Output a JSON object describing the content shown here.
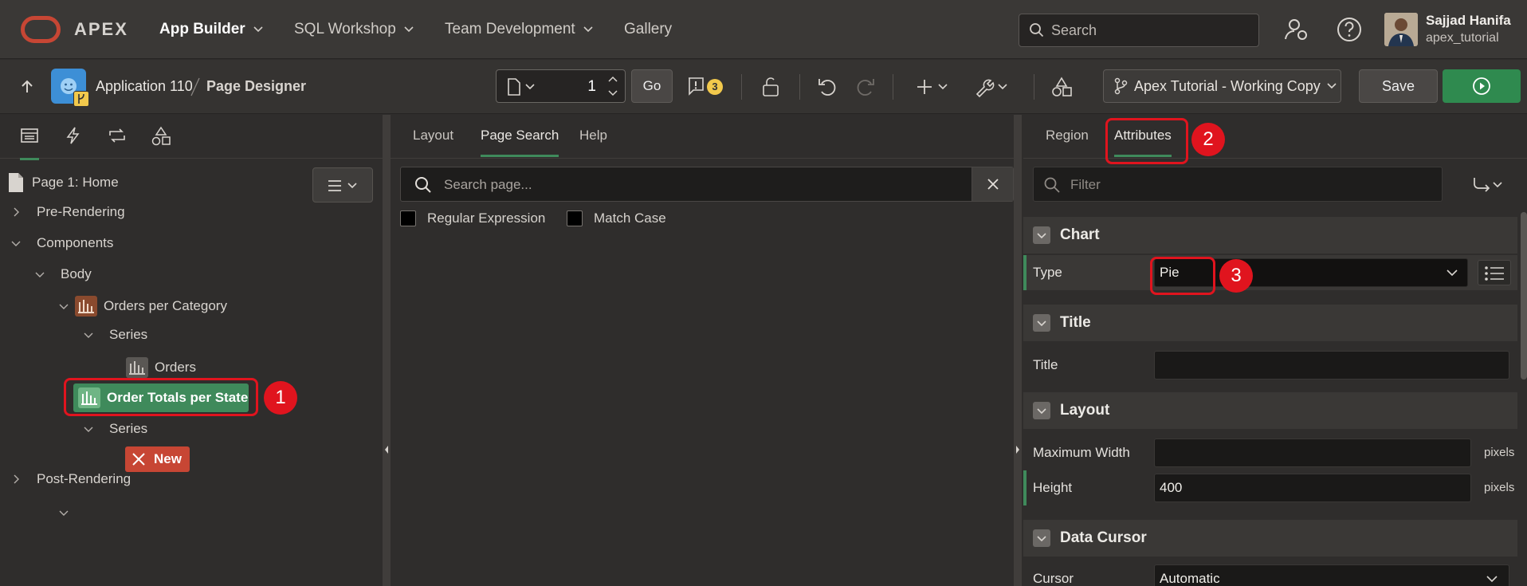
{
  "header": {
    "brand": "APEX",
    "nav": [
      {
        "label": "App Builder",
        "active": true
      },
      {
        "label": "SQL Workshop"
      },
      {
        "label": "Team Development"
      },
      {
        "label": "Gallery"
      }
    ],
    "search_placeholder": "Search",
    "user": {
      "name": "Sajjad Hanifa",
      "workspace": "apex_tutorial"
    }
  },
  "toolbar": {
    "application": "Application 110",
    "page_designer": "Page Designer",
    "page_number": "1",
    "go_label": "Go",
    "warning_count": "3",
    "branch_label": "Apex Tutorial - Working Copy",
    "save_label": "Save"
  },
  "tree": {
    "page": "Page 1: Home",
    "pre_rendering": "Pre-Rendering",
    "components": "Components",
    "body": "Body",
    "region1": "Orders per Category",
    "series1": "Series",
    "orders": "Orders",
    "region2": "Order Totals per State",
    "series2": "Series",
    "new_series": "New",
    "post_rendering": "Post-Rendering"
  },
  "middle": {
    "tabs": [
      "Layout",
      "Page Search",
      "Help"
    ],
    "search_placeholder": "Search page...",
    "regex_label": "Regular Expression",
    "match_case_label": "Match Case"
  },
  "properties": {
    "tabs": [
      "Region",
      "Attributes"
    ],
    "filter_placeholder": "Filter",
    "sections": {
      "chart": "Chart",
      "title": "Title",
      "layout": "Layout",
      "data_cursor": "Data Cursor"
    },
    "rows": {
      "type_label": "Type",
      "type_value": "Pie",
      "title_label": "Title",
      "title_value": "",
      "max_width_label": "Maximum Width",
      "max_width_value": "",
      "max_width_unit": "pixels",
      "height_label": "Height",
      "height_value": "400",
      "height_unit": "pixels",
      "cursor_label": "Cursor",
      "cursor_value": "Automatic"
    }
  },
  "annotations": [
    "1",
    "2",
    "3"
  ],
  "colors": {
    "accent": "#3f8a5b",
    "brand": "#c74634",
    "annotation": "#e0141e",
    "warning": "#f2c94c"
  }
}
